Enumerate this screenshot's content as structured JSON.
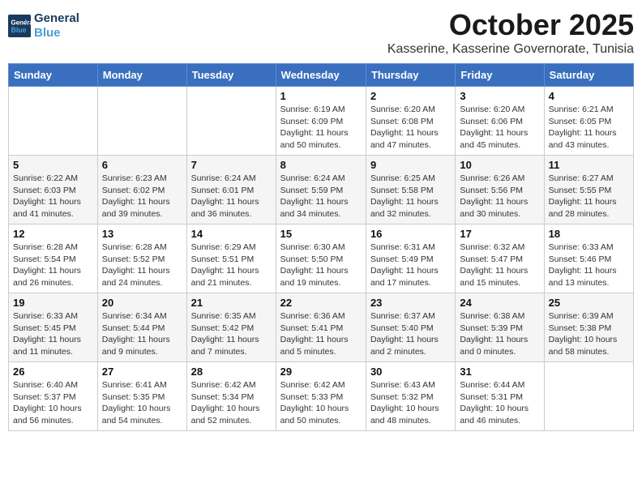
{
  "header": {
    "logo_line1": "General",
    "logo_line2": "Blue",
    "month_title": "October 2025",
    "location": "Kasserine, Kasserine Governorate, Tunisia"
  },
  "weekdays": [
    "Sunday",
    "Monday",
    "Tuesday",
    "Wednesday",
    "Thursday",
    "Friday",
    "Saturday"
  ],
  "weeks": [
    [
      {
        "day": "",
        "info": ""
      },
      {
        "day": "",
        "info": ""
      },
      {
        "day": "",
        "info": ""
      },
      {
        "day": "1",
        "info": "Sunrise: 6:19 AM\nSunset: 6:09 PM\nDaylight: 11 hours and 50 minutes."
      },
      {
        "day": "2",
        "info": "Sunrise: 6:20 AM\nSunset: 6:08 PM\nDaylight: 11 hours and 47 minutes."
      },
      {
        "day": "3",
        "info": "Sunrise: 6:20 AM\nSunset: 6:06 PM\nDaylight: 11 hours and 45 minutes."
      },
      {
        "day": "4",
        "info": "Sunrise: 6:21 AM\nSunset: 6:05 PM\nDaylight: 11 hours and 43 minutes."
      }
    ],
    [
      {
        "day": "5",
        "info": "Sunrise: 6:22 AM\nSunset: 6:03 PM\nDaylight: 11 hours and 41 minutes."
      },
      {
        "day": "6",
        "info": "Sunrise: 6:23 AM\nSunset: 6:02 PM\nDaylight: 11 hours and 39 minutes."
      },
      {
        "day": "7",
        "info": "Sunrise: 6:24 AM\nSunset: 6:01 PM\nDaylight: 11 hours and 36 minutes."
      },
      {
        "day": "8",
        "info": "Sunrise: 6:24 AM\nSunset: 5:59 PM\nDaylight: 11 hours and 34 minutes."
      },
      {
        "day": "9",
        "info": "Sunrise: 6:25 AM\nSunset: 5:58 PM\nDaylight: 11 hours and 32 minutes."
      },
      {
        "day": "10",
        "info": "Sunrise: 6:26 AM\nSunset: 5:56 PM\nDaylight: 11 hours and 30 minutes."
      },
      {
        "day": "11",
        "info": "Sunrise: 6:27 AM\nSunset: 5:55 PM\nDaylight: 11 hours and 28 minutes."
      }
    ],
    [
      {
        "day": "12",
        "info": "Sunrise: 6:28 AM\nSunset: 5:54 PM\nDaylight: 11 hours and 26 minutes."
      },
      {
        "day": "13",
        "info": "Sunrise: 6:28 AM\nSunset: 5:52 PM\nDaylight: 11 hours and 24 minutes."
      },
      {
        "day": "14",
        "info": "Sunrise: 6:29 AM\nSunset: 5:51 PM\nDaylight: 11 hours and 21 minutes."
      },
      {
        "day": "15",
        "info": "Sunrise: 6:30 AM\nSunset: 5:50 PM\nDaylight: 11 hours and 19 minutes."
      },
      {
        "day": "16",
        "info": "Sunrise: 6:31 AM\nSunset: 5:49 PM\nDaylight: 11 hours and 17 minutes."
      },
      {
        "day": "17",
        "info": "Sunrise: 6:32 AM\nSunset: 5:47 PM\nDaylight: 11 hours and 15 minutes."
      },
      {
        "day": "18",
        "info": "Sunrise: 6:33 AM\nSunset: 5:46 PM\nDaylight: 11 hours and 13 minutes."
      }
    ],
    [
      {
        "day": "19",
        "info": "Sunrise: 6:33 AM\nSunset: 5:45 PM\nDaylight: 11 hours and 11 minutes."
      },
      {
        "day": "20",
        "info": "Sunrise: 6:34 AM\nSunset: 5:44 PM\nDaylight: 11 hours and 9 minutes."
      },
      {
        "day": "21",
        "info": "Sunrise: 6:35 AM\nSunset: 5:42 PM\nDaylight: 11 hours and 7 minutes."
      },
      {
        "day": "22",
        "info": "Sunrise: 6:36 AM\nSunset: 5:41 PM\nDaylight: 11 hours and 5 minutes."
      },
      {
        "day": "23",
        "info": "Sunrise: 6:37 AM\nSunset: 5:40 PM\nDaylight: 11 hours and 2 minutes."
      },
      {
        "day": "24",
        "info": "Sunrise: 6:38 AM\nSunset: 5:39 PM\nDaylight: 11 hours and 0 minutes."
      },
      {
        "day": "25",
        "info": "Sunrise: 6:39 AM\nSunset: 5:38 PM\nDaylight: 10 hours and 58 minutes."
      }
    ],
    [
      {
        "day": "26",
        "info": "Sunrise: 6:40 AM\nSunset: 5:37 PM\nDaylight: 10 hours and 56 minutes."
      },
      {
        "day": "27",
        "info": "Sunrise: 6:41 AM\nSunset: 5:35 PM\nDaylight: 10 hours and 54 minutes."
      },
      {
        "day": "28",
        "info": "Sunrise: 6:42 AM\nSunset: 5:34 PM\nDaylight: 10 hours and 52 minutes."
      },
      {
        "day": "29",
        "info": "Sunrise: 6:42 AM\nSunset: 5:33 PM\nDaylight: 10 hours and 50 minutes."
      },
      {
        "day": "30",
        "info": "Sunrise: 6:43 AM\nSunset: 5:32 PM\nDaylight: 10 hours and 48 minutes."
      },
      {
        "day": "31",
        "info": "Sunrise: 6:44 AM\nSunset: 5:31 PM\nDaylight: 10 hours and 46 minutes."
      },
      {
        "day": "",
        "info": ""
      }
    ]
  ]
}
